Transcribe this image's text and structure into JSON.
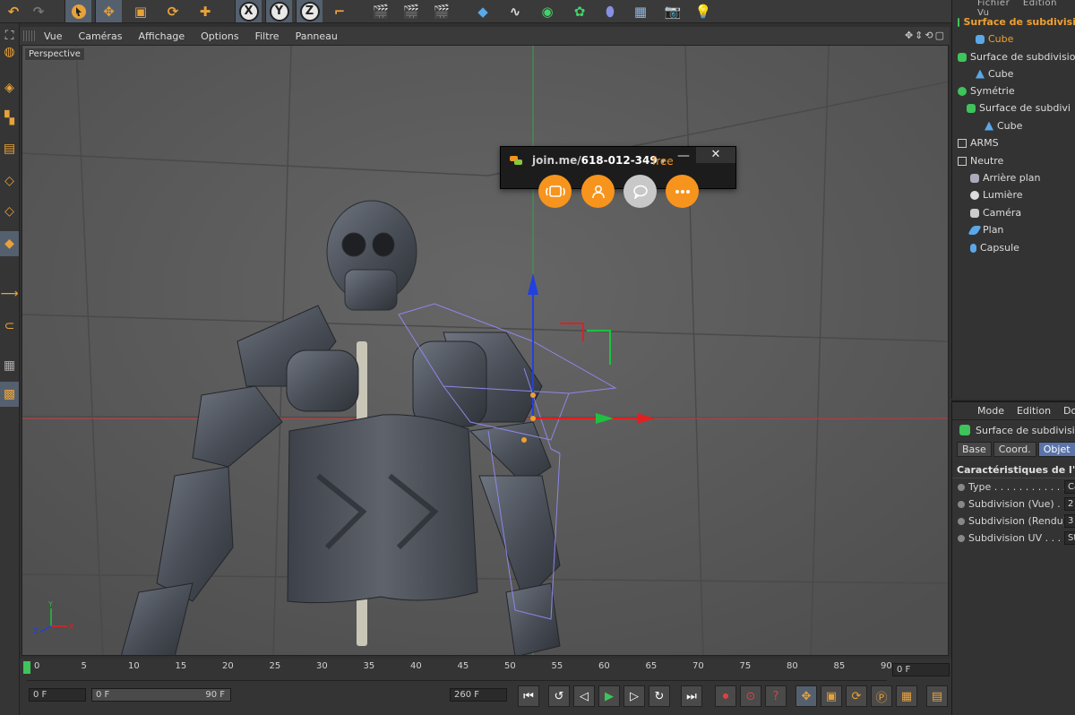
{
  "viewport_menu": {
    "items": [
      "Vue",
      "Caméras",
      "Affichage",
      "Options",
      "Filtre",
      "Panneau"
    ],
    "perspective_label": "Perspective"
  },
  "joinme": {
    "code_prefix": "join.me/",
    "code": "618-012-349",
    "dropdown": "▾",
    "plan": "free",
    "minimize": "—",
    "close": "✕"
  },
  "object_manager": {
    "menu": [
      "Fichier",
      "Edition",
      "Vu"
    ],
    "items": [
      {
        "label": "Surface de subdivisi",
        "icon": "subdivision-icon",
        "selected": true
      },
      {
        "label": "Cube",
        "icon": "cube-icon",
        "selected": true
      },
      {
        "label": "Surface de subdivisio",
        "icon": "subdivision-icon"
      },
      {
        "label": "Cube",
        "icon": "polygon-icon"
      },
      {
        "label": "Symétrie",
        "icon": "symmetry-icon"
      },
      {
        "label": "Surface de subdivi",
        "icon": "subdivision-icon"
      },
      {
        "label": "Cube",
        "icon": "polygon-icon"
      },
      {
        "label": "ARMS",
        "icon": "null-icon"
      },
      {
        "label": "Neutre",
        "icon": "null-icon"
      },
      {
        "label": "Arrière plan",
        "icon": "background-icon"
      },
      {
        "label": "Lumière",
        "icon": "light-icon"
      },
      {
        "label": "Caméra",
        "icon": "camera-icon"
      },
      {
        "label": "Plan",
        "icon": "plane-icon"
      },
      {
        "label": "Capsule",
        "icon": "capsule-icon"
      }
    ]
  },
  "attributes": {
    "menu": [
      "Mode",
      "Edition",
      "Dor"
    ],
    "object_name": "Surface de subdivisi",
    "tabs": [
      "Base",
      "Coord.",
      "Objet"
    ],
    "active_tab": "Objet",
    "section": "Caractéristiques de l'objet",
    "rows": [
      {
        "label": "Type . . . . . . . . . . . . .",
        "value": "Ca"
      },
      {
        "label": "Subdivision (Vue) . .",
        "value": "2"
      },
      {
        "label": "Subdivision (Rendu)",
        "value": "3"
      },
      {
        "label": "Subdivision UV . . . .",
        "value": "St"
      }
    ]
  },
  "timeline": {
    "ticks": [
      "0",
      "5",
      "10",
      "15",
      "20",
      "25",
      "30",
      "35",
      "40",
      "45",
      "50",
      "55",
      "60",
      "65",
      "70",
      "75",
      "80",
      "85",
      "90"
    ],
    "current_frame": "0 F",
    "start_frame": "0 F",
    "range_start": "0 F",
    "range_end": "90 F",
    "end_frame": "260 F"
  },
  "axis_labels": {
    "x": "X",
    "y": "Y",
    "z": "Z"
  },
  "colors": {
    "accent": "#f7941d",
    "selection": "#f0a030",
    "x_axis": "#e02020",
    "y_axis": "#20c040",
    "z_axis": "#2040e0"
  }
}
